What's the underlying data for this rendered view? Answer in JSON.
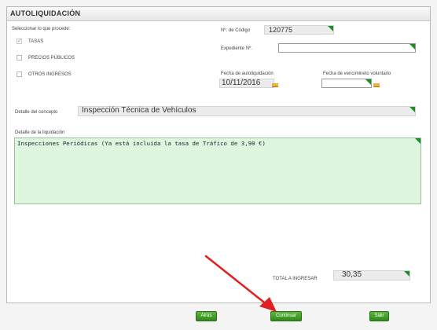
{
  "panel": {
    "title": "AUTOLIQUIDACIÓN"
  },
  "left": {
    "select_label": "Seleccionar lo que procede:",
    "options": [
      {
        "label": "TASAS",
        "checked": true
      },
      {
        "label": "PRECIOS PÚBLICOS",
        "checked": false
      },
      {
        "label": "OTROS INGRESOS",
        "checked": false
      }
    ]
  },
  "right": {
    "codigo_label": "Nº. de Código",
    "codigo_value": "120775",
    "expediente_label": "Expediente Nº.",
    "expediente_value": "",
    "fecha_auto_label": "Fecha de autoliquidación",
    "fecha_auto_value": "10/11/2016",
    "fecha_venc_label": "Fecha de vencimineto voluntario",
    "fecha_venc_value": ""
  },
  "concepto": {
    "label": "Detalle del concepto",
    "value": "Inspección Técnica de Vehículos"
  },
  "liquidacion": {
    "label": "Detalle de la liquidación",
    "value": "Inspecciones Periódicas (Ya está incluida la tasa de Tráfico de 3,90 €)"
  },
  "total": {
    "label": "TOTAL A INGRESAR",
    "value": "30,35"
  },
  "buttons": {
    "back": "Atrás",
    "continue": "Continuar",
    "exit": "Salir"
  },
  "colors": {
    "button_green": "#3f9f28",
    "field_corner": "#1f8c2b",
    "textarea_bg": "#ddf6dd",
    "annotation_arrow": "#e02020"
  },
  "icons": [
    "calendar-icon",
    "dropdown-corner-icon",
    "annotation-arrow"
  ]
}
